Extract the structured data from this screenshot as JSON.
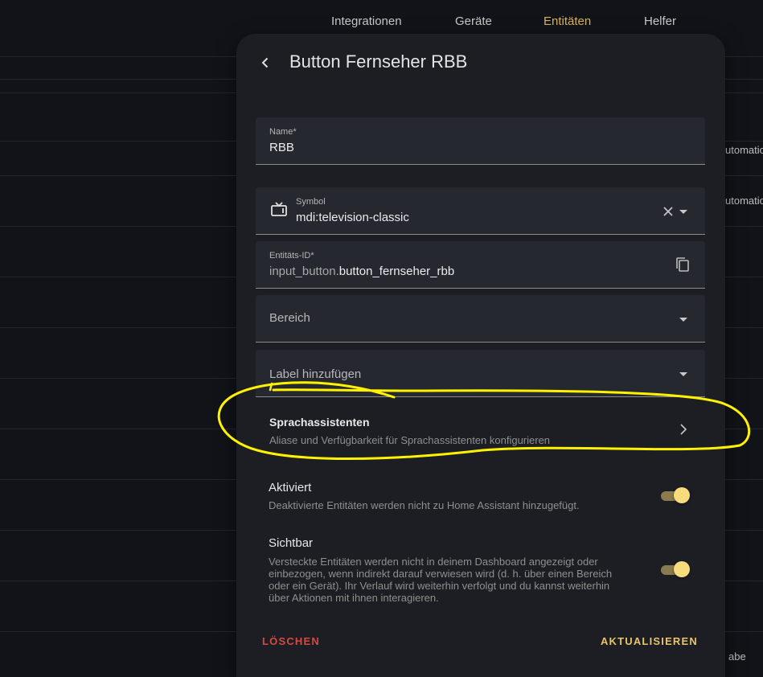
{
  "nav": {
    "tabs": [
      "Integrationen",
      "Geräte",
      "Entitäten",
      "Helfer"
    ]
  },
  "background": {
    "row_labels": [
      "utomatio",
      "utomatio",
      "abe"
    ]
  },
  "dialog": {
    "title": "Button Fernseher RBB",
    "name_field": {
      "label": "Name*",
      "value": "RBB"
    },
    "symbol_field": {
      "label": "Symbol",
      "value": "mdi:television-classic"
    },
    "entity_id_field": {
      "label": "Entitäts-ID*",
      "prefix": "input_button.",
      "value": "button_fernseher_rbb"
    },
    "area_field": {
      "placeholder": "Bereich"
    },
    "label_field": {
      "placeholder": "Label hinzufügen"
    },
    "voice_assistants": {
      "title": "Sprachassistenten",
      "subtitle": "Aliase und Verfügbarkeit für Sprachassistenten konfigurieren"
    },
    "enabled": {
      "title": "Aktiviert",
      "subtitle": "Deaktivierte Entitäten werden nicht zu Home Assistant hinzugefügt.",
      "on": true
    },
    "visible": {
      "title": "Sichtbar",
      "subtitle_lines": [
        "Versteckte Entitäten werden nicht in deinem Dashboard angezeigt oder",
        "einbezogen, wenn indirekt darauf verwiesen wird (d. h. über einen Bereich",
        "oder ein Gerät). Ihr Verlauf wird weiterhin verfolgt und du kannst weiterhin",
        "über Aktionen mit ihnen interagieren."
      ],
      "on": true
    },
    "delete_label": "LÖSCHEN",
    "update_label": "AKTUALISIEREN"
  },
  "colors": {
    "accent": "#d8b35a",
    "danger": "#d54a40",
    "highlight": "#fff200"
  }
}
